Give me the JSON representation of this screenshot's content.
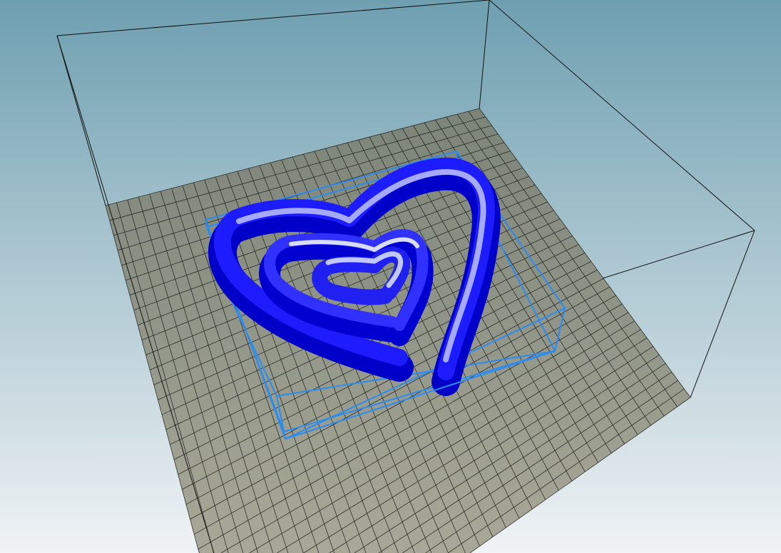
{
  "viewport": {
    "colors": {
      "background_top": "#6e9fb0",
      "background_bottom": "#f0f3f5",
      "build_plate": "#8c8c7e",
      "build_plate_front": "#a8a898",
      "grid_line": "#1a1a1a",
      "volume_edge": "#111111",
      "selection_box": "#2a8cf0",
      "model_dark": "#0000d8",
      "model_mid": "#2a2aff",
      "model_light": "#b8c0ff"
    }
  }
}
